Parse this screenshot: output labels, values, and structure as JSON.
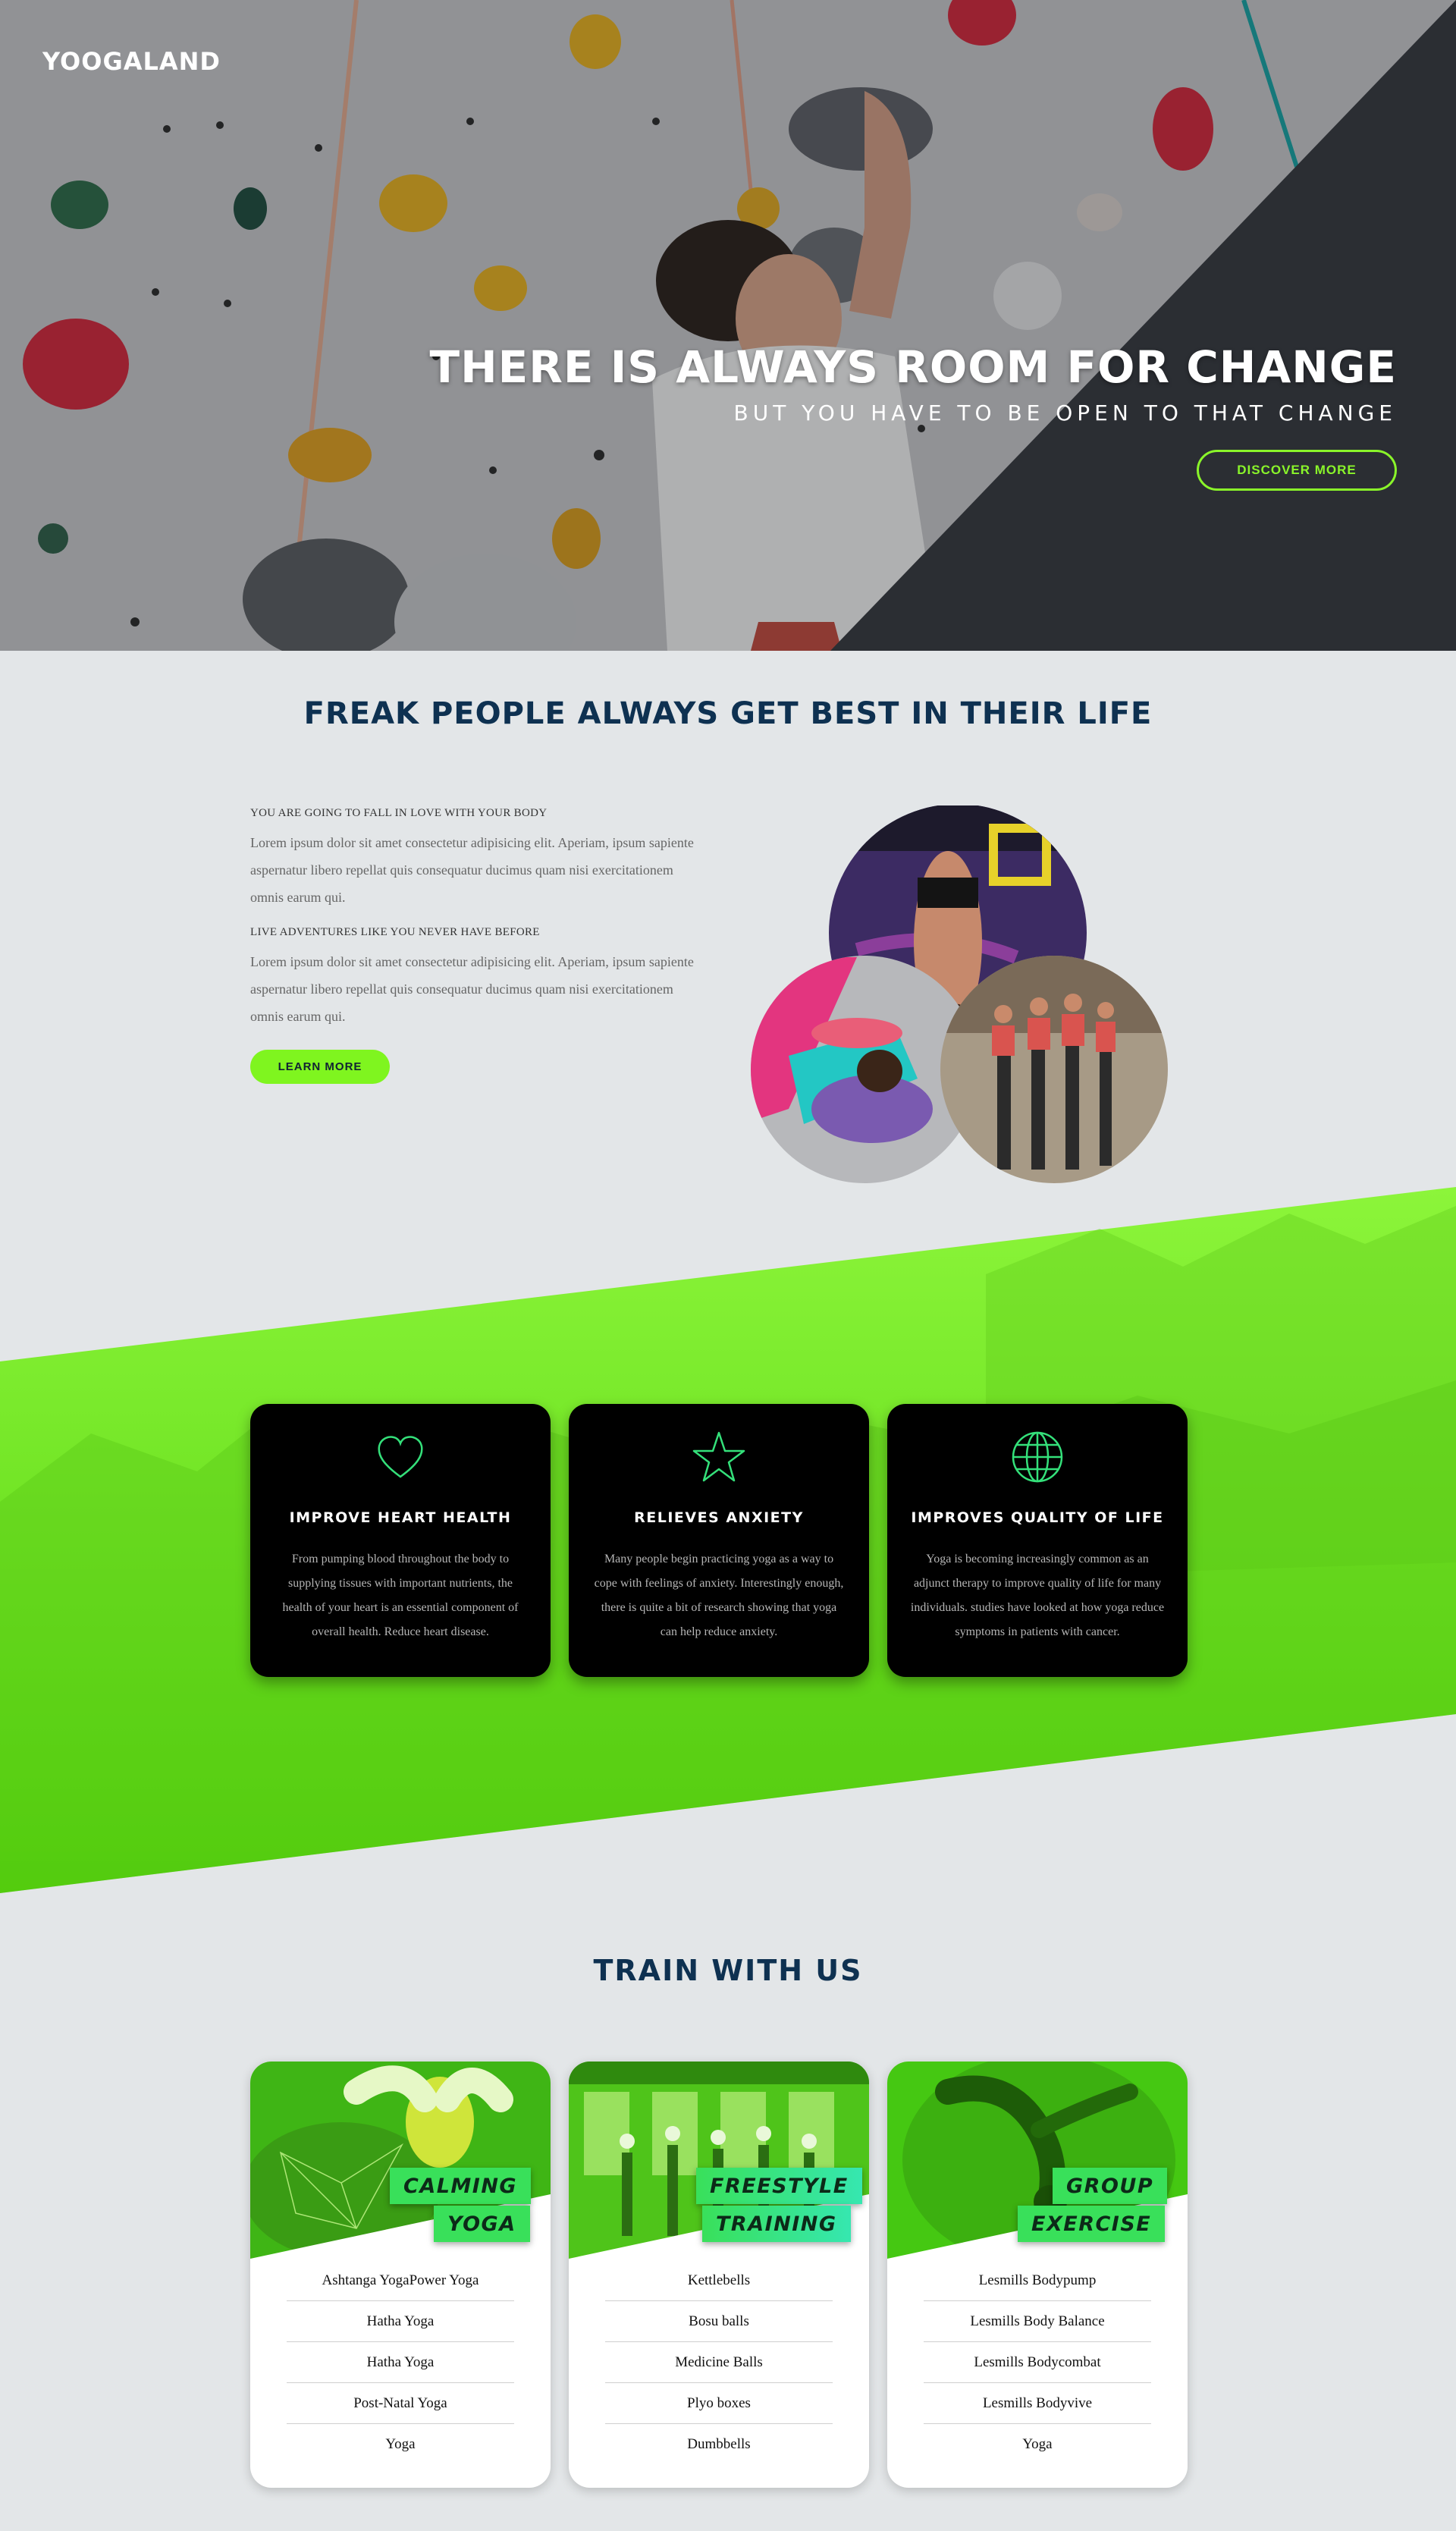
{
  "brand": {
    "logo": "YOOGALAND"
  },
  "hero": {
    "title": "THERE IS ALWAYS ROOM FOR CHANGE",
    "subtitle": "BUT YOU HAVE TO BE OPEN TO THAT CHANGE",
    "button": "DISCOVER MORE"
  },
  "freak": {
    "title": "FREAK PEOPLE ALWAYS GET BEST IN THEIR LIFE",
    "blocks": [
      {
        "heading": "YOU ARE GOING TO FALL IN LOVE WITH YOUR BODY",
        "body": "Lorem ipsum dolor sit amet consectetur adipisicing elit. Aperiam, ipsum sapiente aspernatur libero repellat quis consequatur ducimus quam nisi exercitationem omnis earum qui."
      },
      {
        "heading": "LIVE ADVENTURES LIKE YOU NEVER HAVE BEFORE",
        "body": "Lorem ipsum dolor sit amet consectetur adipisicing elit. Aperiam, ipsum sapiente aspernatur libero repellat quis consequatur ducimus quam nisi exercitationem omnis earum qui."
      }
    ],
    "button": "LEARN MORE"
  },
  "benefits": [
    {
      "icon": "heart-icon",
      "title": "IMPROVE HEART HEALTH",
      "text": "From pumping blood throughout the body to supplying tissues with important nutrients, the health of your heart is an essential component of overall health. Reduce heart disease."
    },
    {
      "icon": "star-icon",
      "title": "RELIEVES ANXIETY",
      "text": "Many people begin practicing yoga as a way to cope with feelings of anxiety. Interestingly enough, there is quite a bit of research showing that yoga can help reduce anxiety."
    },
    {
      "icon": "globe-icon",
      "title": "IMPROVES QUALITY OF LIFE",
      "text": "Yoga is becoming increasingly common as an adjunct therapy to improve quality of life for many individuals. studies have looked at how yoga reduce symptoms in patients with cancer."
    }
  ],
  "train": {
    "title": "TRAIN WITH US",
    "cards": [
      {
        "label1": "CALMING",
        "label2": "YOGA",
        "items": [
          "Ashtanga YogaPower Yoga",
          "Hatha Yoga",
          "Hatha Yoga",
          "Post-Natal Yoga",
          "Yoga"
        ]
      },
      {
        "label1": "FREESTYLE",
        "label2": "TRAINING",
        "items": [
          "Kettlebells",
          "Bosu balls",
          "Medicine Balls",
          "Plyo boxes",
          "Dumbbells"
        ]
      },
      {
        "label1": "GROUP",
        "label2": "EXERCISE",
        "items": [
          "Lesmills Bodypump",
          "Lesmills Body Balance",
          "Lesmills Bodycombat",
          "Lesmills Bodyvive",
          "Yoga"
        ]
      }
    ]
  },
  "colors": {
    "accent": "#7ff51f",
    "navy": "#0e3151",
    "dark": "#2b2e33",
    "label_green": "#39e05a",
    "label_teal": "#36e7b0"
  }
}
